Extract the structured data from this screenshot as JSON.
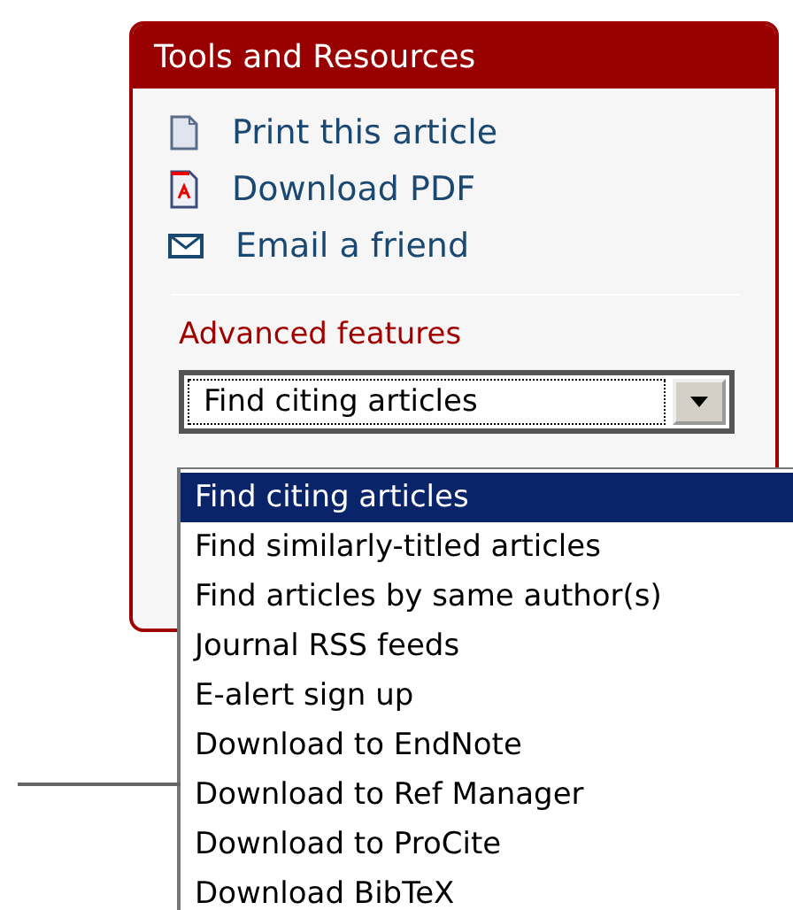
{
  "panel": {
    "title": "Tools and Resources",
    "links": [
      {
        "kind": "print",
        "label": "Print this article"
      },
      {
        "kind": "pdf",
        "label": "Download PDF"
      },
      {
        "kind": "email",
        "label": "Email a friend"
      }
    ],
    "advanced_label": "Advanced features",
    "select": {
      "value": "Find citing articles",
      "expanded": true,
      "options": [
        {
          "label": "Find citing articles",
          "selected": true
        },
        {
          "label": "Find similarly-titled articles",
          "selected": false
        },
        {
          "label": "Find articles by same author(s)",
          "selected": false
        },
        {
          "label": "Journal RSS feeds",
          "selected": false
        },
        {
          "label": "E-alert sign up",
          "selected": false
        },
        {
          "label": "Download to EndNote",
          "selected": false
        },
        {
          "label": "Download to Ref Manager",
          "selected": false
        },
        {
          "label": "Download to ProCite",
          "selected": false
        },
        {
          "label": "Download BibTeX",
          "selected": false
        }
      ]
    }
  }
}
